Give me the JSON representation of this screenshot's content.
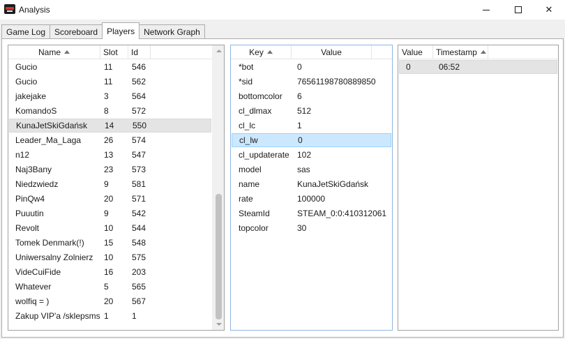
{
  "window": {
    "title": "Analysis",
    "icon": "app-logo-icon",
    "controls": [
      "minimize",
      "maximize",
      "close"
    ]
  },
  "tabs": [
    {
      "label": "Game Log",
      "active": false
    },
    {
      "label": "Scoreboard",
      "active": false
    },
    {
      "label": "Players",
      "active": true
    },
    {
      "label": "Network Graph",
      "active": false
    }
  ],
  "players": {
    "columns": {
      "name": "Name",
      "slot": "Slot",
      "id": "Id"
    },
    "sort_column": "Name",
    "sort_direction": "ascending",
    "rows": [
      {
        "name": "Gucio",
        "slot": "11",
        "id": "546"
      },
      {
        "name": "Gucio",
        "slot": "11",
        "id": "562"
      },
      {
        "name": "jakejake",
        "slot": "3",
        "id": "564"
      },
      {
        "name": "KomandoS",
        "slot": "8",
        "id": "572"
      },
      {
        "name": "KunaJetSkiGdańsk",
        "slot": "14",
        "id": "550"
      },
      {
        "name": "Leader_Ma_Laga",
        "slot": "26",
        "id": "574"
      },
      {
        "name": "n12",
        "slot": "13",
        "id": "547"
      },
      {
        "name": "Naj3Bany",
        "slot": "23",
        "id": "573"
      },
      {
        "name": "Niedzwiedz",
        "slot": "9",
        "id": "581"
      },
      {
        "name": "PinQw4",
        "slot": "20",
        "id": "571"
      },
      {
        "name": "Puuutin",
        "slot": "9",
        "id": "542"
      },
      {
        "name": "Revolt",
        "slot": "10",
        "id": "544"
      },
      {
        "name": "Tomek Denmark(!)",
        "slot": "15",
        "id": "548"
      },
      {
        "name": "Uniwersalny Zolnierz",
        "slot": "10",
        "id": "575"
      },
      {
        "name": "VideCuiFide",
        "slot": "16",
        "id": "203"
      },
      {
        "name": "Whatever",
        "slot": "5",
        "id": "565"
      },
      {
        "name": "wolfiq = )",
        "slot": "20",
        "id": "567"
      },
      {
        "name": "Zakup VIP'a /sklepsms",
        "slot": "1",
        "id": "1"
      }
    ],
    "selected_index": 4
  },
  "properties": {
    "columns": {
      "key": "Key",
      "value": "Value"
    },
    "sort_column": "Key",
    "rows": [
      {
        "key": "*bot",
        "value": "0"
      },
      {
        "key": "*sid",
        "value": "76561198780889850"
      },
      {
        "key": "bottomcolor",
        "value": "6"
      },
      {
        "key": "cl_dlmax",
        "value": "512"
      },
      {
        "key": "cl_lc",
        "value": "1"
      },
      {
        "key": "cl_lw",
        "value": "0"
      },
      {
        "key": "cl_updaterate",
        "value": "102"
      },
      {
        "key": "model",
        "value": "sas"
      },
      {
        "key": "name",
        "value": "KunaJetSkiGdańsk"
      },
      {
        "key": "rate",
        "value": "100000"
      },
      {
        "key": "SteamId",
        "value": "STEAM_0:0:410312061"
      },
      {
        "key": "topcolor",
        "value": "30"
      }
    ],
    "selected_index": 5
  },
  "history": {
    "columns": {
      "value": "Value",
      "timestamp": "Timestamp"
    },
    "sort_column": "Timestamp",
    "rows": [
      {
        "value": "0",
        "timestamp": "06:52"
      }
    ],
    "selected_index": 0
  },
  "colors": {
    "selection_inactive": "#e4e4e4",
    "selection_active": "#cce8ff",
    "selection_active_border": "#99d1ff",
    "window_bg": "#f0f0f0"
  }
}
